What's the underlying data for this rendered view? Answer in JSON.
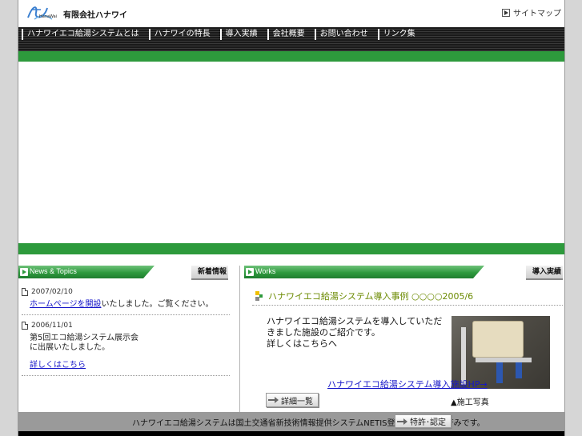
{
  "header": {
    "logo_text": "HanaWai",
    "company": "有限会社ハナワイ",
    "sitemap_label": "サイトマップ"
  },
  "nav": {
    "items": [
      "ハナワイエコ給湯システムとは",
      "ハナワイの特長",
      "導入実績",
      "会社概要",
      "お問い合わせ",
      "リンク集"
    ]
  },
  "news": {
    "header_title": "News & Topics",
    "header_jp": "新着情報",
    "entries": [
      {
        "date": "2007/02/10",
        "link": "ホームページを開設",
        "text": "いたしました。ご覧ください。"
      },
      {
        "date": "2006/11/01",
        "text": "第5回エコ給湯システム展示会に出展いたしました。",
        "link": "詳しくはこちら"
      }
    ]
  },
  "works": {
    "header_title": "Works",
    "header_jp": "導入実績",
    "title": "ハナワイエコ給湯システム導入事例 ○○○○2005/6",
    "desc": "ハナワイエコ給湯システムを導入していただきました施設のご紹介です。",
    "desc2": "詳しくはこちらへ",
    "hp_link": "ハナワイエコ給湯システム導入施設HP→",
    "more_label": "詳細一覧",
    "caption": "▲施工写真"
  },
  "footer": {
    "text": "ハナワイエコ給湯システムは国土交通省新技術情報提供システムNETIS登録・ 特許取得済みです。",
    "patent_label": "特許･認定"
  }
}
